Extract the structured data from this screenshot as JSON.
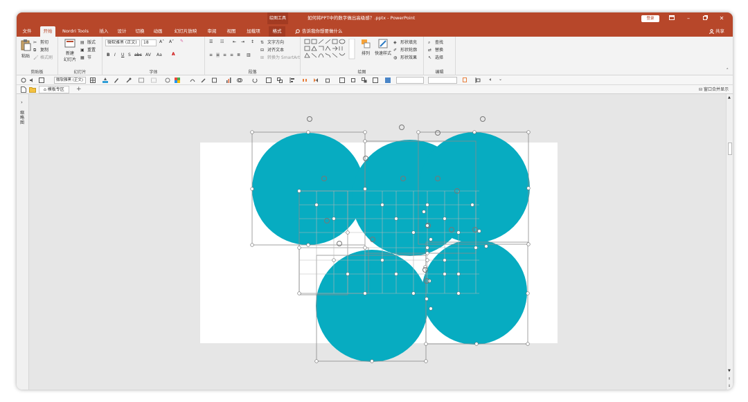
{
  "window": {
    "context_tab_title": "绘图工具",
    "doc_title": "如何将PPT中的数字做出高级感？.pptx  -  PowerPoint",
    "login_label": "登录",
    "controls": [
      "restore-ribbon-icon",
      "minimize-icon",
      "maximize-icon",
      "close-icon"
    ]
  },
  "tabs": [
    {
      "label": "文件",
      "active": false
    },
    {
      "label": "开始",
      "active": true
    },
    {
      "label": "Nordri Tools",
      "active": false
    },
    {
      "label": "插入",
      "active": false
    },
    {
      "label": "设计",
      "active": false
    },
    {
      "label": "切换",
      "active": false
    },
    {
      "label": "动画",
      "active": false
    },
    {
      "label": "幻灯片放映",
      "active": false
    },
    {
      "label": "审阅",
      "active": false
    },
    {
      "label": "视图",
      "active": false
    },
    {
      "label": "加载项",
      "active": false
    },
    {
      "label": "格式",
      "active": false
    }
  ],
  "tell_me": "告诉我你想要做什么",
  "share": "共享",
  "ribbon": {
    "clipboard": {
      "label": "剪贴板",
      "paste": "粘贴",
      "cut": "剪切",
      "copy": "复制",
      "format_painter": "格式刷"
    },
    "slides": {
      "label": "幻灯片",
      "new_slide": "新建",
      "new_slide2": "幻灯片",
      "layout": "版式",
      "reset": "重置",
      "section": "节"
    },
    "font": {
      "label": "字体",
      "font_name": "微软雅黑 (正文)",
      "font_size": "18"
    },
    "paragraph": {
      "label": "段落",
      "text_direction": "文字方向",
      "align_text": "对齐文本",
      "smartart": "转换为 SmartArt"
    },
    "drawing": {
      "label": "绘图",
      "arrange": "排列",
      "quick_styles": "快速样式",
      "fill": "形状填充",
      "outline": "形状轮廓",
      "effects": "形状效果"
    },
    "editing": {
      "label": "编辑",
      "find": "查找",
      "replace": "替换",
      "select": "选择"
    }
  },
  "qat": {
    "font_name": "微软雅黑 (正文)"
  },
  "docbar": {
    "template_tab": "模板专区",
    "merge": "窗口合并显示"
  },
  "thumbpane": {
    "label": "缩略图"
  },
  "colors": {
    "accent": "#b7472a",
    "shape_fill": "#07acc1"
  }
}
